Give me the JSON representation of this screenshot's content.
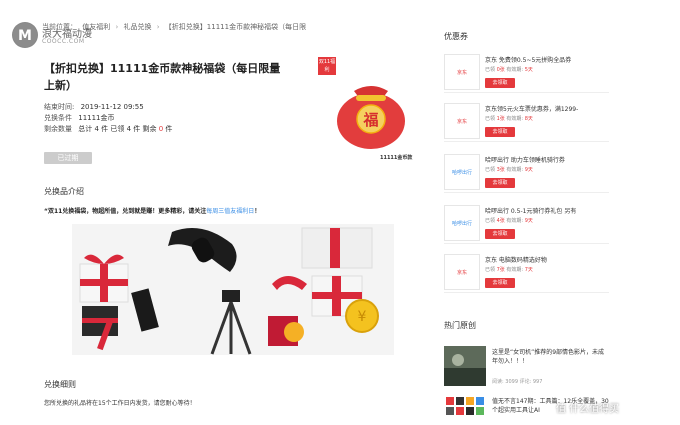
{
  "site": {
    "logo_text": "浪大福动漫",
    "logo_sub": "COOCC.COM"
  },
  "breadcrumb": {
    "items": [
      "当前位置：",
      "值友福利",
      "礼品兑换",
      "【折扣兑换】11111金币款神秘福袋（每日限"
    ]
  },
  "product": {
    "title": "【折扣兑换】11111金币款神秘福袋（每日限量上新）",
    "end_time_label": "结束时间:",
    "end_time": "2019-11-12 09:55",
    "condition_label": "兑换条件",
    "condition": "11111金币",
    "remaining_label": "剩余数量",
    "remaining_prefix": "总计 4 件 已领 4 件 剩余 ",
    "remaining_count": "0",
    "remaining_suffix": " 件",
    "expired_button": "已过期",
    "tag_text": "双11福利",
    "bag_char": "福",
    "image_caption": "11111金币款"
  },
  "description": {
    "heading": "兑换品介绍",
    "text": "“双11兑换福袋，物超所值，兑到就是赚！更多精彩，请关注",
    "link": "每周三值友福利日",
    "end": "！"
  },
  "rules": {
    "heading": "兑换细则",
    "text": "您所兑换的礼品将在15个工作日内发货，请您耐心等待！"
  },
  "coupons": {
    "heading": "优惠券",
    "items": [
      {
        "logo": "京东",
        "title": "京东 免费领0.5~5元拼购全品券",
        "claimed_label": "已领",
        "claimed": "0张",
        "valid_label": "有效期",
        "valid": "5天",
        "btn": "去领取"
      },
      {
        "logo": "京东",
        "title": "京东领5元火车票优惠券，满1299-",
        "claimed_label": "已领",
        "claimed": "1张",
        "valid_label": "有效期",
        "valid": "8天",
        "btn": "去领取"
      },
      {
        "logo": "哈啰出行",
        "title": "哈啰出行 助力车领睡机骑行券",
        "claimed_label": "已领",
        "claimed": "3张",
        "valid_label": "有效期",
        "valid": "9天",
        "btn": "去领取"
      },
      {
        "logo": "哈啰出行",
        "title": "哈啰出行 0.5-1元骑行券礼包 另有",
        "claimed_label": "已领",
        "claimed": "4张",
        "valid_label": "有效期",
        "valid": "9天",
        "btn": "去领取"
      },
      {
        "logo": "京东",
        "title": "京东 电脑数码精选好物",
        "claimed_label": "已领",
        "claimed": "7张",
        "valid_label": "有效期",
        "valid": "7天",
        "btn": "去领取"
      }
    ]
  },
  "hot": {
    "heading": "热门原创",
    "items": [
      {
        "title": "这里是“女司机”推荐的9部情色影片，未成年勿入！！！",
        "meta": "阅读: 3099  评论: 997"
      },
      {
        "title": "值无不言147期：工具篇：12乐全覆盖，30个超实用工具让AI",
        "meta": ""
      }
    ]
  },
  "watermark": "值 什么值得买"
}
